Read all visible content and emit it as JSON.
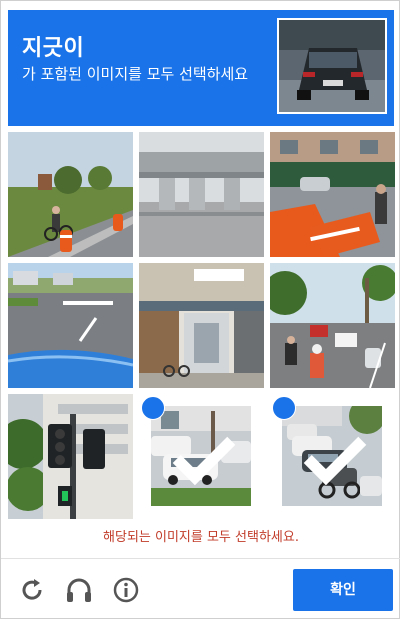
{
  "header": {
    "title": "지긋이",
    "subtitle": "가 포함된 이미지를 모두 선택하세요",
    "sample_image": "car-rear-on-road"
  },
  "tiles": [
    {
      "scene": "road-with-cyclist-and-orange-barrels",
      "selected": false
    },
    {
      "scene": "elevated-highway-pillars",
      "selected": false
    },
    {
      "scene": "street-with-orange-traffic-barriers",
      "selected": false
    },
    {
      "scene": "road-with-car-hood",
      "selected": false
    },
    {
      "scene": "shop-front",
      "selected": false
    },
    {
      "scene": "busy-street-with-motorbikes",
      "selected": false
    },
    {
      "scene": "traffic-light-and-building",
      "selected": false
    },
    {
      "scene": "cars-in-parking-lot",
      "selected": true
    },
    {
      "scene": "cars-and-motorbikes-on-street",
      "selected": true
    }
  ],
  "error_message": "해당되는 이미지를 모두 선택하세요.",
  "footer": {
    "reload_icon": "reload-icon",
    "audio_icon": "headphones-icon",
    "info_icon": "info-icon",
    "verify_label": "확인"
  },
  "colors": {
    "accent": "#1a73e8",
    "error": "#c13c2a"
  }
}
